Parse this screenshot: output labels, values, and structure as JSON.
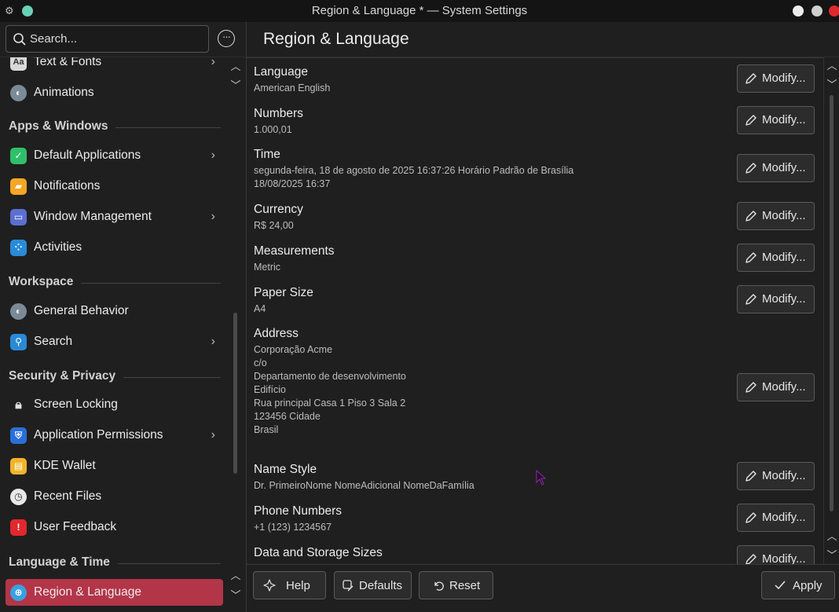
{
  "window": {
    "title": "Region & Language * — System Settings"
  },
  "sidebar": {
    "search_placeholder": "Search...",
    "items": [
      {
        "label": "Text & Fonts",
        "icon": "text-fonts-icon",
        "has_children": true
      },
      {
        "label": "Animations",
        "icon": "animations-icon",
        "has_children": false
      },
      {
        "section": "Apps & Windows"
      },
      {
        "label": "Default Applications",
        "icon": "default-apps-icon",
        "has_children": true
      },
      {
        "label": "Notifications",
        "icon": "notifications-icon",
        "has_children": false
      },
      {
        "label": "Window Management",
        "icon": "window-management-icon",
        "has_children": true
      },
      {
        "label": "Activities",
        "icon": "activities-icon",
        "has_children": false
      },
      {
        "section": "Workspace"
      },
      {
        "label": "General Behavior",
        "icon": "general-behavior-icon",
        "has_children": false
      },
      {
        "label": "Search",
        "icon": "search-settings-icon",
        "has_children": true
      },
      {
        "section": "Security & Privacy"
      },
      {
        "label": "Screen Locking",
        "icon": "lock-icon",
        "has_children": false
      },
      {
        "label": "Application Permissions",
        "icon": "permissions-icon",
        "has_children": true
      },
      {
        "label": "KDE Wallet",
        "icon": "wallet-icon",
        "has_children": false
      },
      {
        "label": "Recent Files",
        "icon": "recent-files-icon",
        "has_children": false
      },
      {
        "label": "User Feedback",
        "icon": "feedback-icon",
        "has_children": false
      },
      {
        "section": "Language & Time"
      },
      {
        "label": "Region & Language",
        "icon": "region-language-icon",
        "has_children": false,
        "active": true
      }
    ]
  },
  "main": {
    "title": "Region & Language",
    "modify_label": "Modify...",
    "settings": [
      {
        "title": "Language",
        "value": [
          "American English"
        ]
      },
      {
        "title": "Numbers",
        "value": [
          "1.000,01"
        ]
      },
      {
        "title": "Time",
        "value": [
          "segunda-feira, 18 de agosto de 2025 16:37:26 Horário Padrão de Brasília",
          "18/08/2025 16:37"
        ]
      },
      {
        "title": "Currency",
        "value": [
          "R$ 24,00"
        ]
      },
      {
        "title": "Measurements",
        "value": [
          "Metric"
        ]
      },
      {
        "title": "Paper Size",
        "value": [
          "A4"
        ]
      },
      {
        "title": "Address",
        "value": [
          "Corporação Acme",
          "c/o",
          "Departamento de desenvolvimento",
          "Edifício",
          "Rua principal Casa 1 Piso 3 Sala 2",
          "123456 Cidade",
          "Brasil"
        ]
      },
      {
        "title": "Name Style",
        "value": [
          "Dr. PrimeiroNome NomeAdicional NomeDaFamília"
        ]
      },
      {
        "title": "Phone Numbers",
        "value": [
          "+1 (123) 1234567"
        ]
      },
      {
        "title": "Data and Storage Sizes",
        "value": []
      }
    ]
  },
  "footer": {
    "help_label": "Help",
    "defaults_label": "Defaults",
    "reset_label": "Reset",
    "apply_label": "Apply"
  },
  "colors": {
    "accent_active": "#b33548",
    "background": "#1f1f1f",
    "titlebar": "#141414",
    "close_button": "#e0282e"
  }
}
